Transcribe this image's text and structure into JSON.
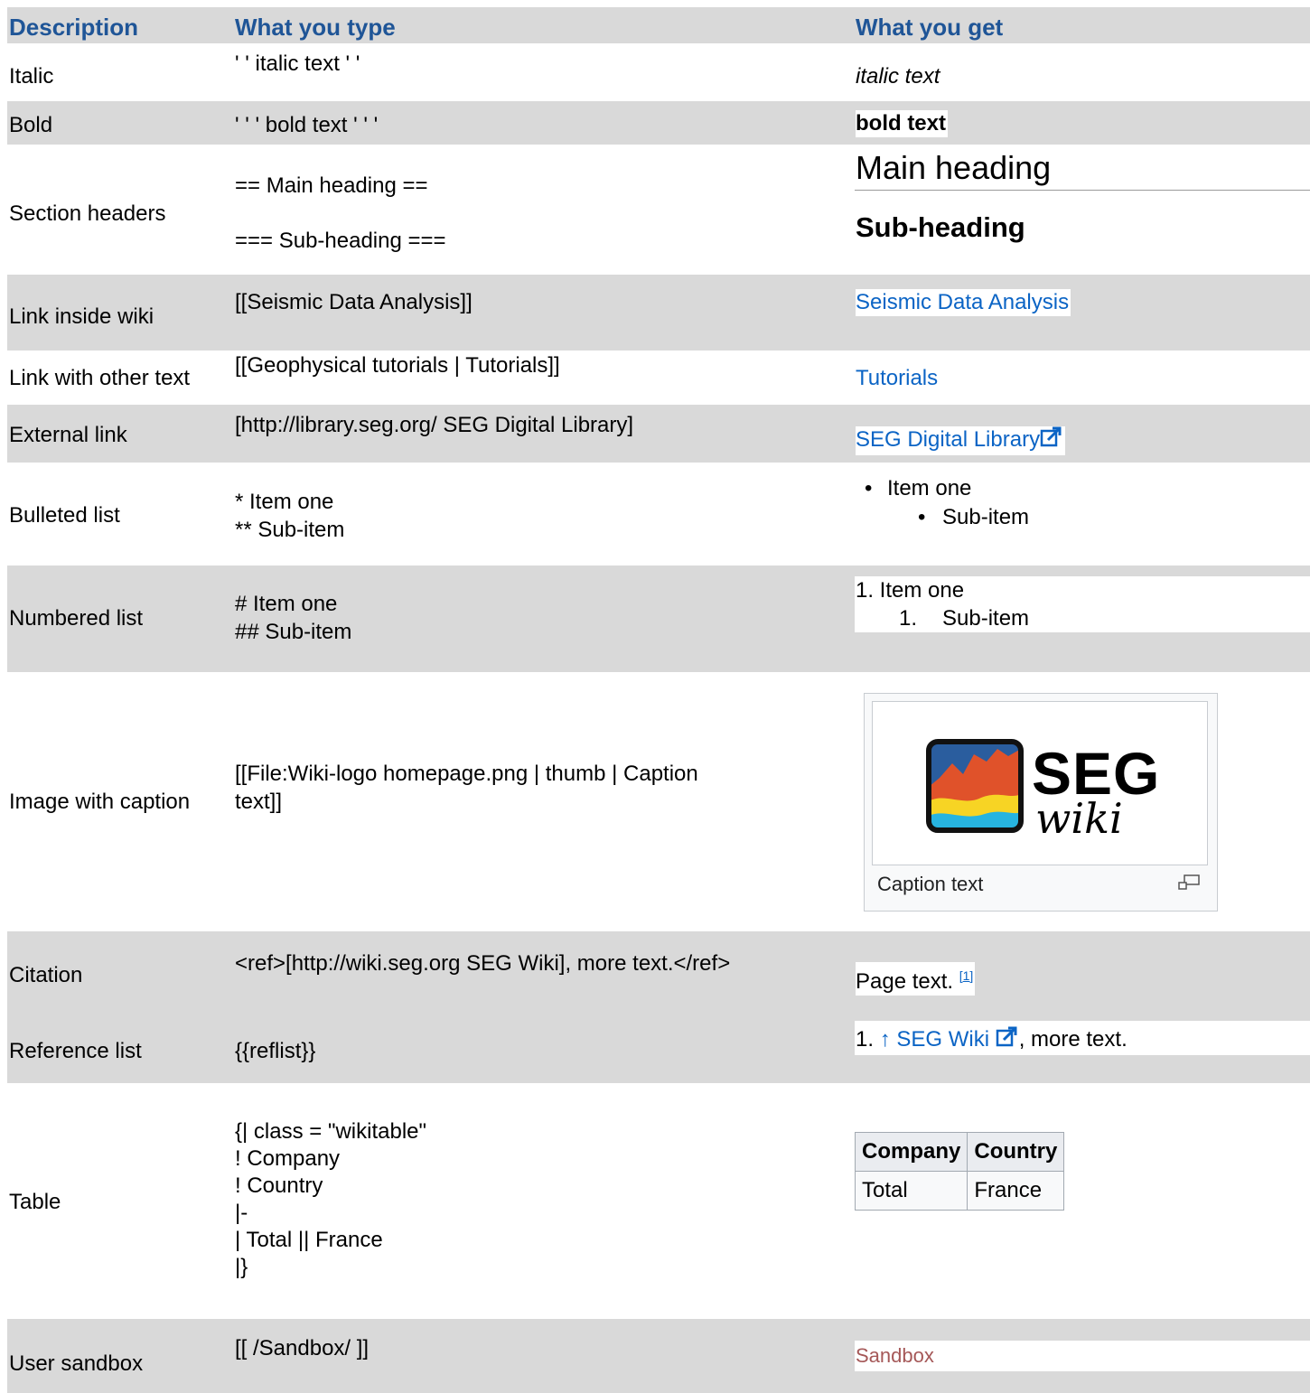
{
  "headers": {
    "description": "Description",
    "what_you_type": "What you type",
    "what_you_get": "What you get"
  },
  "rows": {
    "italic": {
      "desc": "Italic",
      "type": "' ' italic text ' '",
      "get": "italic text"
    },
    "bold": {
      "desc": "Bold",
      "type": "' ' ' bold text ' ' '",
      "get": "bold text"
    },
    "section": {
      "desc": "Section headers",
      "type1": "== Main heading ==",
      "type2": "=== Sub-heading ===",
      "get_main": "Main heading",
      "get_sub": "Sub-heading"
    },
    "link_inside": {
      "desc": "Link inside wiki",
      "type": "[[Seismic Data Analysis]]",
      "get": "Seismic Data Analysis"
    },
    "link_other": {
      "desc": "Link with other text",
      "type": "[[Geophysical tutorials | Tutorials]]",
      "get": "Tutorials"
    },
    "external": {
      "desc": "External link",
      "type": "[http://library.seg.org/ SEG Digital Library]",
      "get": "SEG Digital Library"
    },
    "bulleted": {
      "desc": "Bulleted list",
      "type1": "* Item one",
      "type2": "** Sub-item",
      "get1": "Item one",
      "get2": "Sub-item",
      "bullet": "•"
    },
    "numbered": {
      "desc": "Numbered list",
      "type1": "# Item one",
      "type2": "## Sub-item",
      "get1": "1. Item one",
      "get2_num": "1.",
      "get2": "Sub-item"
    },
    "image": {
      "desc": "Image with caption",
      "type1": "[[File:Wiki-logo homepage.png | thumb | Caption",
      "type2": "text]]",
      "logo_seg": "SEG",
      "logo_wiki": "wiki",
      "caption": "Caption text"
    },
    "citation": {
      "desc": "Citation",
      "type": "<ref>[http://wiki.seg.org SEG Wiki], more text.</ref>",
      "get": "Page text. ",
      "sup": "[1]"
    },
    "reflist": {
      "desc": "Reference list",
      "type": "{{reflist}}",
      "num": "1. ",
      "arrow": "↑",
      "link": "SEG Wiki",
      "rest": ", more text."
    },
    "table": {
      "desc": "Table",
      "lines": [
        "{| class = \"wikitable\"",
        "! Company",
        "! Country",
        "|-",
        "| Total  || France",
        "|}"
      ],
      "headers": [
        "Company",
        "Country"
      ],
      "cells": [
        "Total",
        "France"
      ]
    },
    "sandbox": {
      "desc": "User sandbox",
      "type": "[[ /Sandbox/ ]]",
      "get": "Sandbox"
    }
  },
  "colors": {
    "header": "#1f5597",
    "row_gray": "#d9d9d9",
    "link": "#0b64c5",
    "visited_link": "#a55858"
  },
  "icons": {
    "external_link": "external-link-icon",
    "enlarge": "enlarge-icon"
  }
}
